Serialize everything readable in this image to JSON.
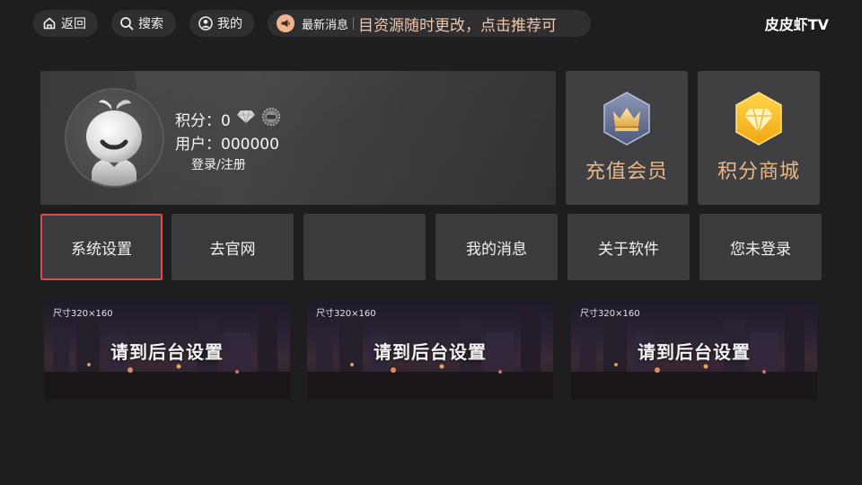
{
  "topbar": {
    "back_label": "返回",
    "search_label": "搜索",
    "mine_label": "我的",
    "news_label": "最新消息",
    "news_text": "目资源随时更改，点击推荐可",
    "brand": "皮皮虾TV"
  },
  "profile": {
    "points_label": "积分：0",
    "user_label": "用户：000000",
    "login_label": "登录/注册"
  },
  "tiles": {
    "vip_label": "充值会员",
    "shop_label": "积分商城"
  },
  "menu": {
    "items": [
      "系统设置",
      "去官网",
      "",
      "我的消息",
      "关于软件",
      "您未登录"
    ]
  },
  "banners": [
    {
      "size_tag": "尺寸320×160",
      "title": "请到后台设置"
    },
    {
      "size_tag": "尺寸320×160",
      "title": "请到后台设置"
    },
    {
      "size_tag": "尺寸320×160",
      "title": "请到后台设置"
    }
  ],
  "colors": {
    "background": "#1e1e1f",
    "accent_gold": "#e8b886",
    "focus_border": "#e0484a",
    "news_icon": "#f0b291"
  }
}
